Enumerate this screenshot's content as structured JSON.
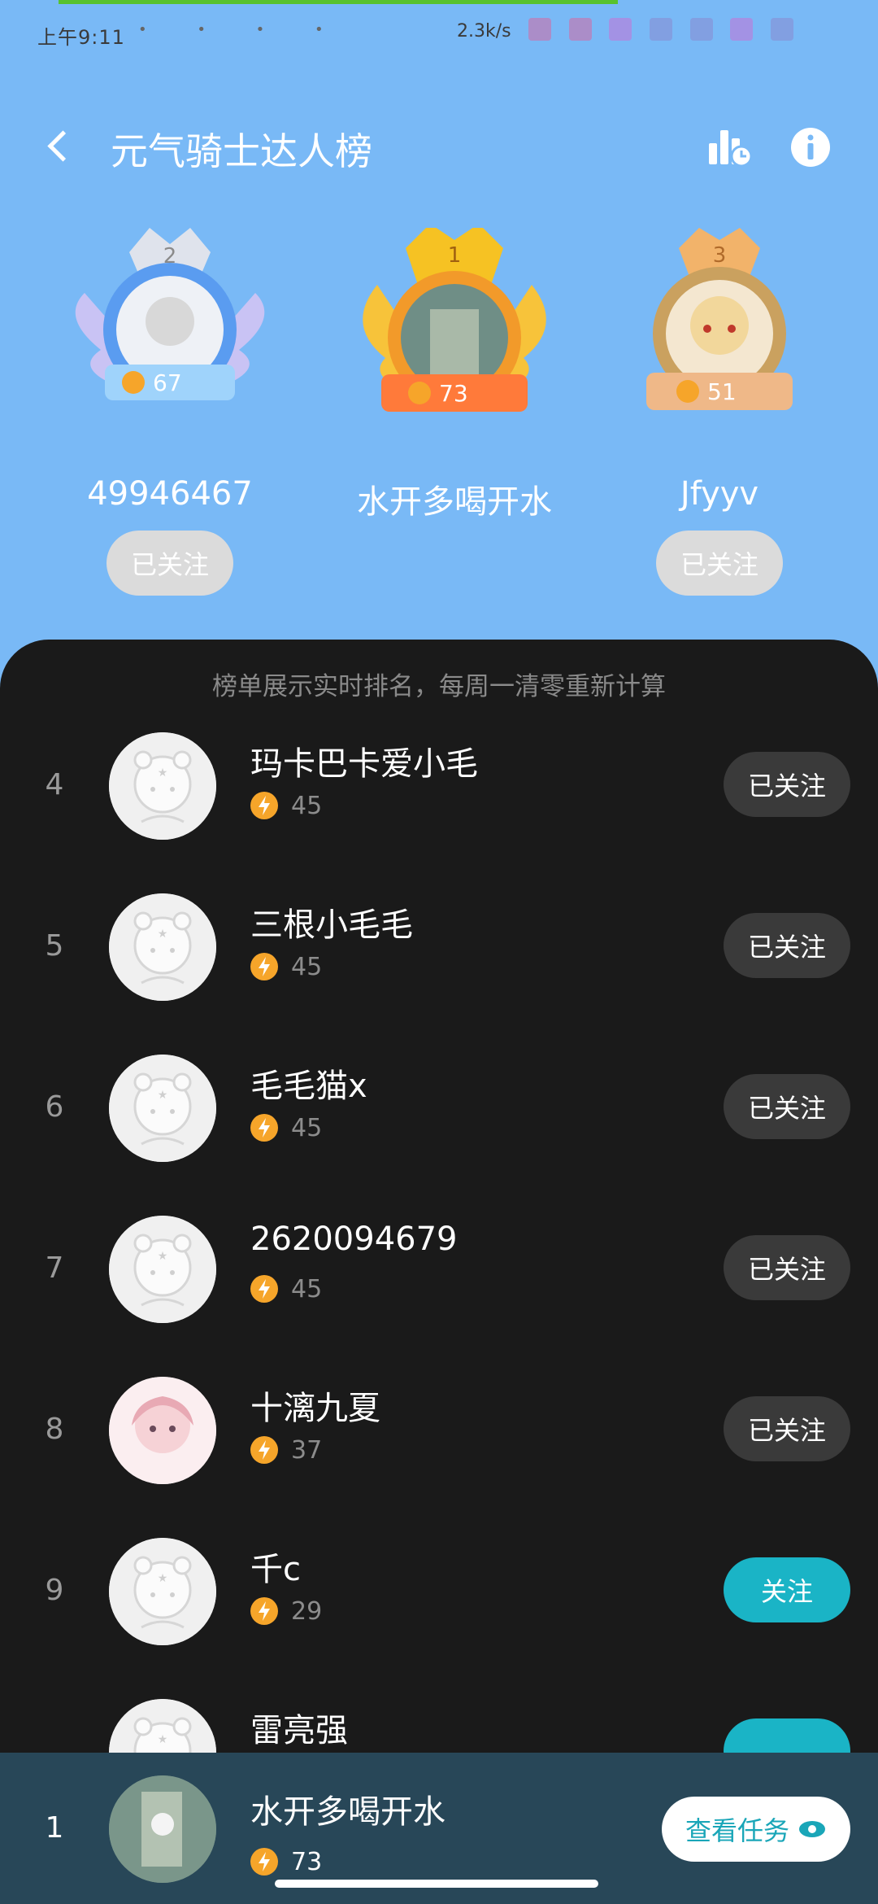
{
  "status_bar": {
    "time": "上午9:11",
    "net_speed": "2.3k/s"
  },
  "header": {
    "title": "元气骑士达人榜"
  },
  "podium": [
    {
      "rank": "2",
      "name": "49946467",
      "score": "67",
      "follow_label": "已关注"
    },
    {
      "rank": "1",
      "name": "水开多喝开水",
      "score": "73",
      "follow_label": ""
    },
    {
      "rank": "3",
      "name": "Jfyyv",
      "score": "51",
      "follow_label": "已关注"
    }
  ],
  "notice": "榜单展示实时排名，每周一清零重新计算",
  "list": [
    {
      "rank": "4",
      "name": "玛卡巴卡爱小毛",
      "score": "45",
      "button": "已关注"
    },
    {
      "rank": "5",
      "name": "三根小毛毛",
      "score": "45",
      "button": "已关注"
    },
    {
      "rank": "6",
      "name": "毛毛猫x",
      "score": "45",
      "button": "已关注"
    },
    {
      "rank": "7",
      "name": "2620094679",
      "score": "45",
      "button": "已关注"
    },
    {
      "rank": "8",
      "name": "十漓九夏",
      "score": "37",
      "button": "已关注"
    },
    {
      "rank": "9",
      "name": "千c",
      "score": "29",
      "button": "关注"
    },
    {
      "rank": "",
      "name": "雷亮强",
      "score": "",
      "button": ""
    }
  ],
  "self": {
    "rank": "1",
    "name": "水开多喝开水",
    "score": "73",
    "task_label": "查看任务"
  },
  "colors": {
    "header_bg": "#79b9f6",
    "panel_bg": "#1a1a1a",
    "follow_active": "#1ab4c6",
    "followed": "#3a3a3a",
    "bolt": "#f6a52a"
  }
}
